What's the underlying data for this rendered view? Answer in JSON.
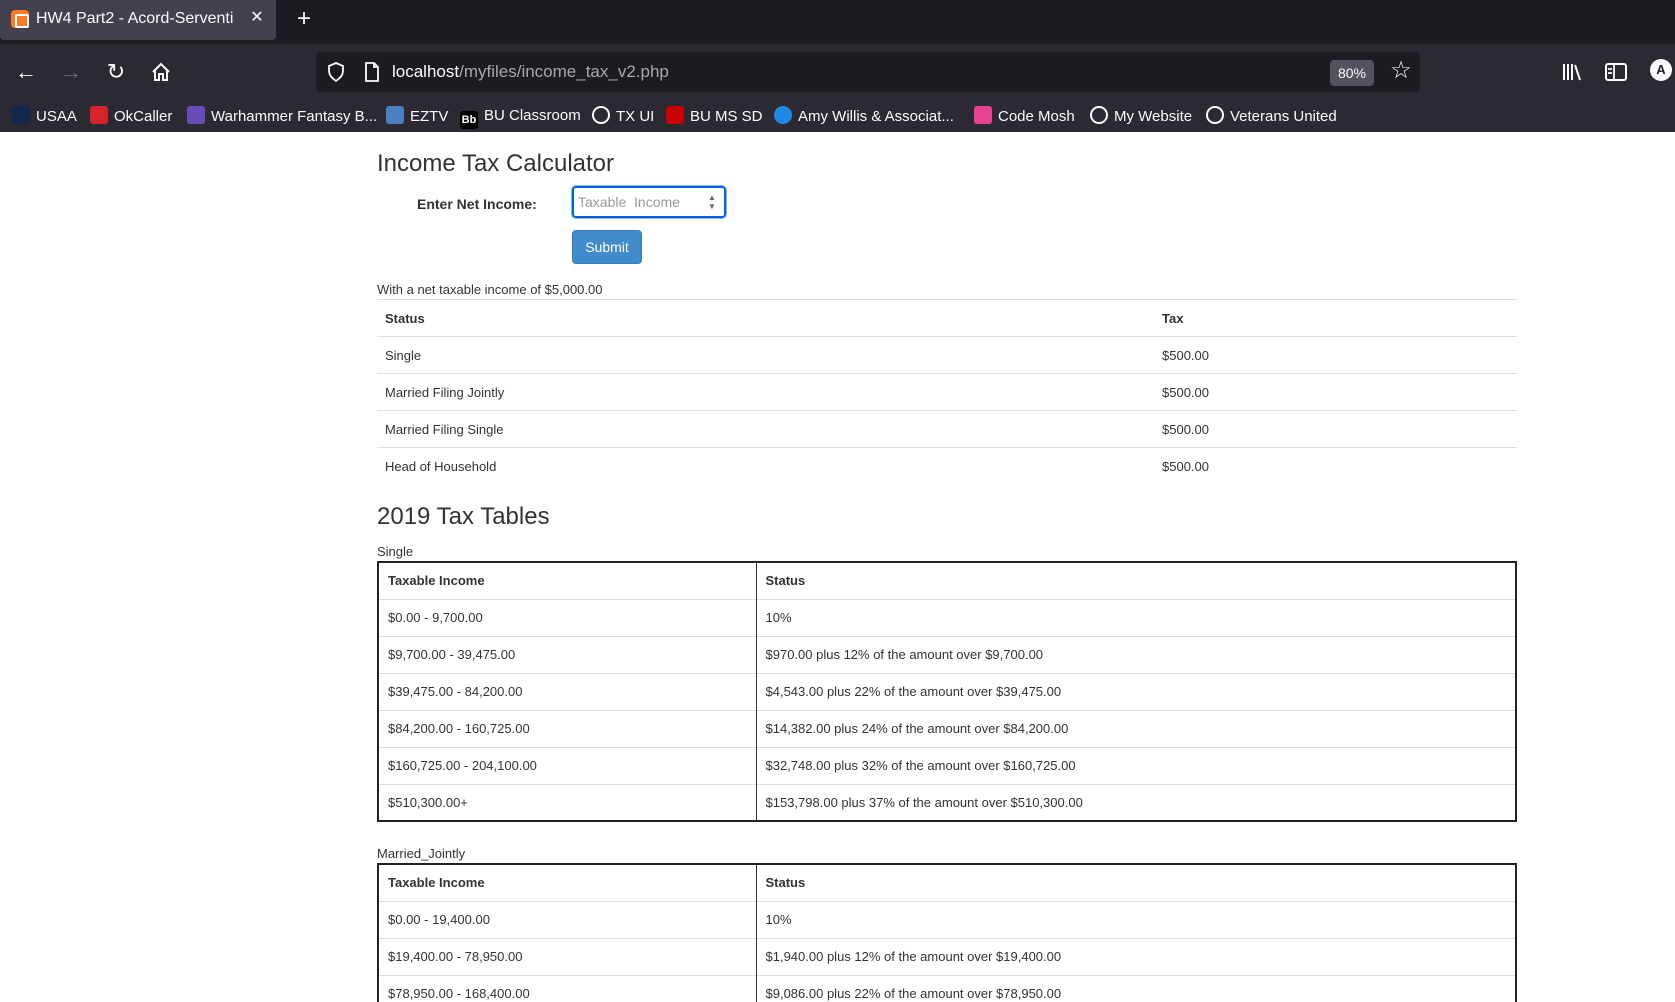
{
  "browser": {
    "tab_title": "HW4 Part2 - Acord-Serventi",
    "url_host": "localhost",
    "url_path": "/myfiles/income_tax_v2.php",
    "zoom": "80%",
    "account_initial": "A",
    "bookmarks": [
      {
        "label": "USAA",
        "color": "#12284c"
      },
      {
        "label": "OkCaller",
        "color": "#d6232a"
      },
      {
        "label": "Warhammer Fantasy B...",
        "color": "#6a4cb8"
      },
      {
        "label": "EZTV",
        "color": "#4a7fc1"
      },
      {
        "label": "BU Classroom",
        "color": "#000000"
      },
      {
        "label": "TX UI",
        "color": "globe"
      },
      {
        "label": "BU MS SD",
        "color": "#cc0000"
      },
      {
        "label": "Amy Willis & Associat...",
        "color": "#1e88e5"
      },
      {
        "label": "Code Mosh",
        "color": "#e84393"
      },
      {
        "label": "My Website",
        "color": "globe"
      },
      {
        "label": "Veterans United",
        "color": "globe"
      }
    ]
  },
  "calculator": {
    "title": "Income Tax Calculator",
    "income_label": "Enter Net Income:",
    "income_placeholder": "Taxable  Income",
    "submit_label": "Submit",
    "result_text": "With a net taxable income of $5,000.00",
    "result_headers": [
      "Status",
      "Tax"
    ],
    "result_rows": [
      [
        "Single",
        "$500.00"
      ],
      [
        "Married Filing Jointly",
        "$500.00"
      ],
      [
        "Married Filing Single",
        "$500.00"
      ],
      [
        "Head of Household",
        "$500.00"
      ]
    ]
  },
  "tax_tables": {
    "title": "2019 Tax Tables",
    "tables": [
      {
        "caption": "Single",
        "headers": [
          "Taxable Income",
          "Status"
        ],
        "rows": [
          [
            "$0.00 - 9,700.00",
            "10%"
          ],
          [
            "$9,700.00 - 39,475.00",
            "$970.00 plus 12% of the amount over $9,700.00"
          ],
          [
            "$39,475.00 - 84,200.00",
            "$4,543.00 plus 22% of the amount over $39,475.00"
          ],
          [
            "$84,200.00 - 160,725.00",
            "$14,382.00 plus 24% of the amount over $84,200.00"
          ],
          [
            "$160,725.00 - 204,100.00",
            "$32,748.00 plus 32% of the amount over $160,725.00"
          ],
          [
            "$510,300.00+",
            "$153,798.00 plus 37% of the amount over $510,300.00"
          ]
        ]
      },
      {
        "caption": "Married_Jointly",
        "headers": [
          "Taxable Income",
          "Status"
        ],
        "rows": [
          [
            "$0.00 - 19,400.00",
            "10%"
          ],
          [
            "$19,400.00 - 78,950.00",
            "$1,940.00 plus 12% of the amount over $19,400.00"
          ],
          [
            "$78,950.00 - 168,400.00",
            "$9,086.00 plus 22% of the amount over $78,950.00"
          ]
        ]
      }
    ]
  }
}
